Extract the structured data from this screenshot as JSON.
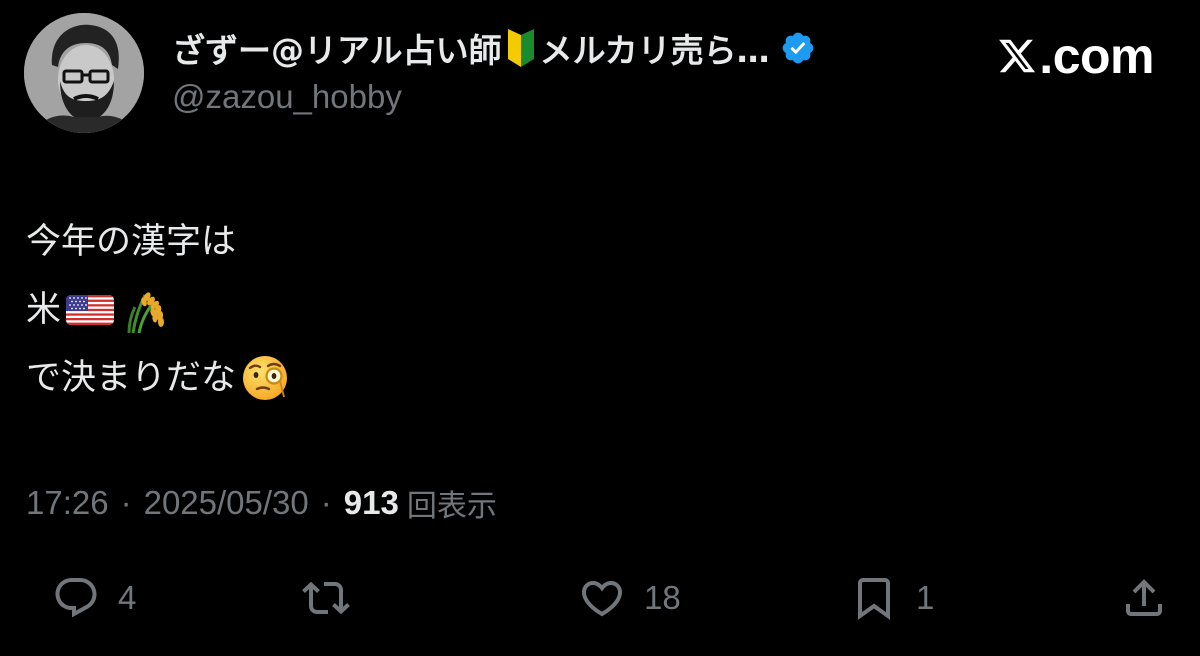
{
  "author": {
    "display_name": "ざずー@リアル占い師",
    "display_name_tail": "メルカリ売ら…",
    "handle": "@zazou_hobby",
    "verified": true
  },
  "brand": {
    "label": ".com"
  },
  "tweet": {
    "lines": [
      "今年の漢字は",
      "米",
      "で決まりだな"
    ],
    "emojis": [
      "beginner-mark",
      "us-flag",
      "rice-plant",
      "face-with-monocle"
    ]
  },
  "meta": {
    "time": "17:26",
    "date": "2025/05/30",
    "separator": "·",
    "views_count": "913",
    "views_label": "回表示"
  },
  "actions": {
    "reply_count": "4",
    "retweet_count": "",
    "like_count": "18",
    "bookmark_count": "1"
  },
  "colors": {
    "background": "#000000",
    "primary_text": "#e7e9ea",
    "secondary_text": "#71767b",
    "verified_blue": "#1d9bf0"
  }
}
